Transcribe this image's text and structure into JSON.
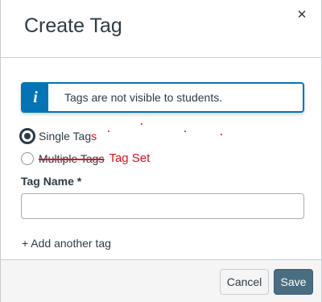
{
  "dialog": {
    "title": "Create Tag",
    "close_icon": "close-icon"
  },
  "alert": {
    "icon": "info-icon",
    "icon_glyph": "i",
    "text": "Tags are not visible to students.",
    "accent_color": "#0374b5"
  },
  "tag_type": {
    "options": [
      {
        "label": "Single Tag",
        "annotation_suffix": "s",
        "checked": true
      },
      {
        "label": "Multiple Tags",
        "annotation_replacement": "Tag Set",
        "checked": false
      }
    ]
  },
  "tag_name": {
    "label": "Tag Name *",
    "value": "",
    "placeholder": ""
  },
  "add_tag": {
    "label": "+ Add another tag"
  },
  "footer": {
    "cancel_label": "Cancel",
    "save_label": "Save",
    "save_color": "#4a6d81"
  },
  "annotation_color": "#e0101a"
}
